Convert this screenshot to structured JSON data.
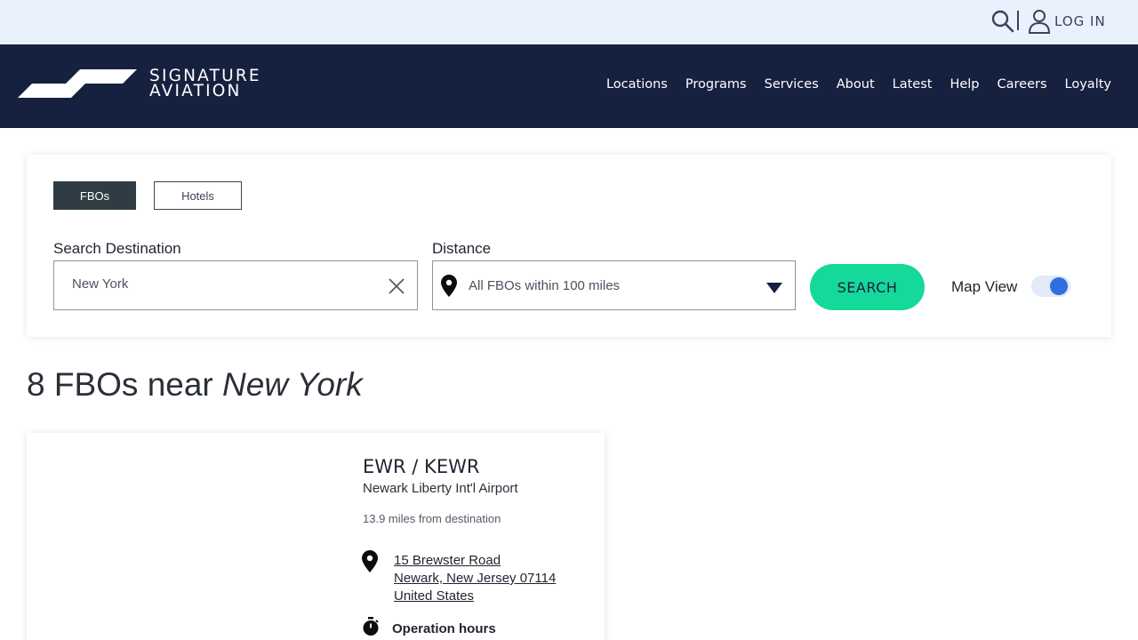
{
  "utility_bar": {
    "login_label": "LOG IN"
  },
  "brand": {
    "line1": "SIGNATURE",
    "line2": "AVIATION"
  },
  "nav": {
    "items": [
      "Locations",
      "Programs",
      "Services",
      "About",
      "Latest",
      "Help",
      "Careers",
      "Loyalty"
    ]
  },
  "search": {
    "tabs": {
      "fbos": "FBOs",
      "hotels": "Hotels",
      "active": "FBOs"
    },
    "destination_label": "Search Destination",
    "destination_value": "New York",
    "distance_label": "Distance",
    "distance_value": "All FBOs within 100 miles",
    "search_button": "SEARCH",
    "map_view_label": "Map View",
    "map_view_on": true
  },
  "results": {
    "count_text": "8 FBOs near",
    "query": "New York",
    "cards": [
      {
        "code": "EWR / KEWR",
        "airport": "Newark Liberty Int'l Airport",
        "distance": "13.9 miles from destination",
        "address_line1": "15 Brewster Road",
        "address_line2": "Newark, New Jersey 07114",
        "address_line3": "United States",
        "hours_label": "Operation hours"
      }
    ]
  },
  "colors": {
    "utility_bg": "#e9f1fd",
    "navbar_bg": "#16213f",
    "accent_green": "#14d99a",
    "active_tab": "#2f3c44",
    "toggle_knob": "#2f6fe0"
  }
}
